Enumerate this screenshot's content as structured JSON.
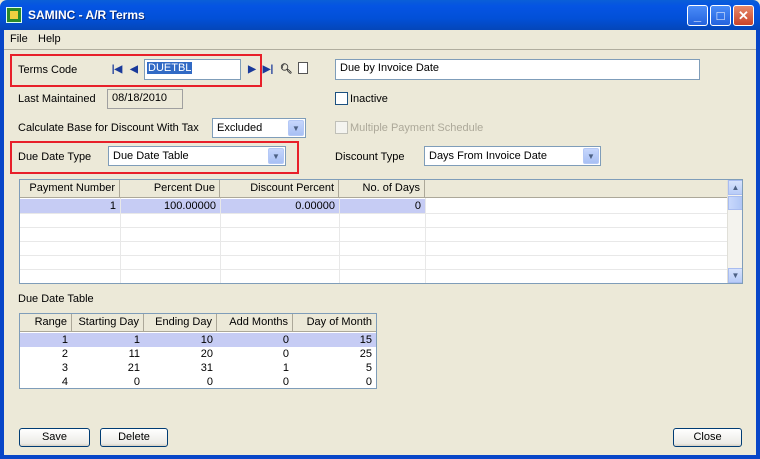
{
  "window": {
    "title": "SAMINC - A/R Terms"
  },
  "menu": {
    "file": "File",
    "help": "Help"
  },
  "terms_code": {
    "label": "Terms Code",
    "value": "DUETBL",
    "description": "Due by Invoice Date"
  },
  "last_maintained": {
    "label": "Last Maintained",
    "value": "08/18/2010"
  },
  "inactive": {
    "label": "Inactive",
    "checked": false
  },
  "calc_base": {
    "label": "Calculate Base for Discount With Tax",
    "value": "Excluded"
  },
  "multiple_payment": {
    "label": "Multiple Payment Schedule",
    "enabled": false
  },
  "due_date_type": {
    "label": "Due Date Type",
    "value": "Due Date Table"
  },
  "discount_type": {
    "label": "Discount Type",
    "value": "Days From Invoice Date"
  },
  "payment_grid": {
    "columns": [
      "Payment Number",
      "Percent Due",
      "Discount Percent",
      "No. of Days"
    ],
    "rows": [
      [
        "1",
        "100.00000",
        "0.00000",
        "0"
      ]
    ]
  },
  "due_date_table": {
    "label": "Due Date Table",
    "columns": [
      "Range",
      "Starting Day",
      "Ending Day",
      "Add Months",
      "Day of Month"
    ],
    "rows": [
      [
        "1",
        "1",
        "10",
        "0",
        "15"
      ],
      [
        "2",
        "11",
        "20",
        "0",
        "25"
      ],
      [
        "3",
        "21",
        "31",
        "1",
        "5"
      ],
      [
        "4",
        "0",
        "0",
        "0",
        "0"
      ]
    ]
  },
  "buttons": {
    "save": "Save",
    "delete": "Delete",
    "close": "Close"
  },
  "colors": {
    "highlight_box": "#e8202a",
    "selected_row": "#c6ccf4",
    "titlebar": "#0554e3"
  }
}
